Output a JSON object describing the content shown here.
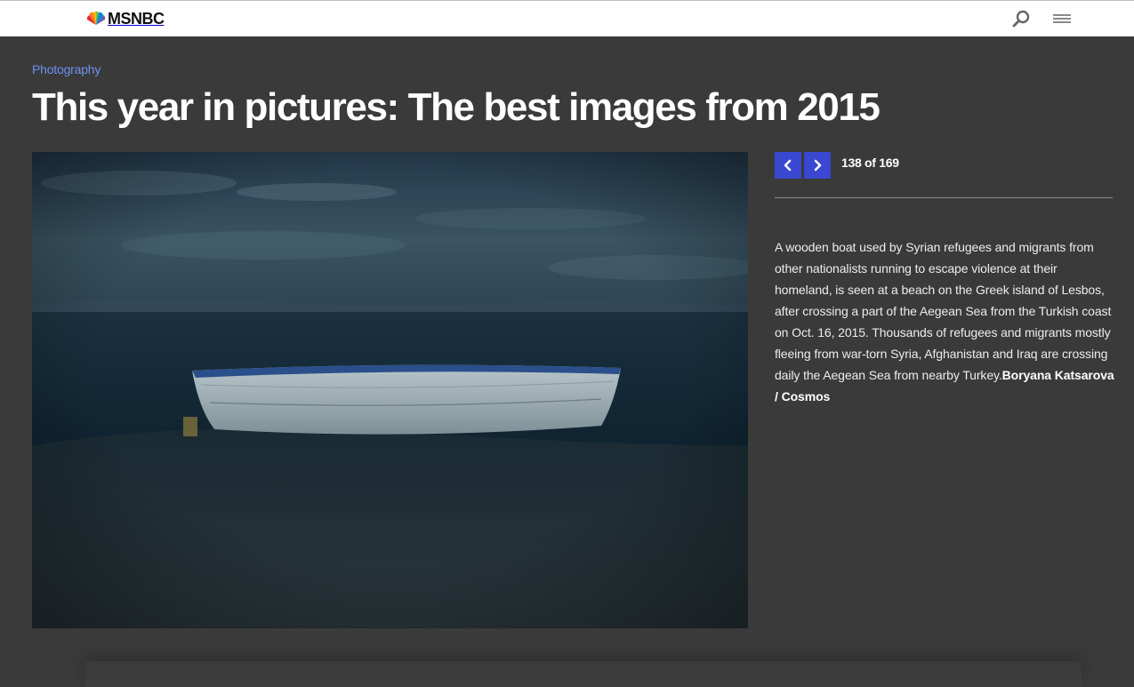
{
  "header": {
    "logo_text": "MSNBC",
    "search_icon": "search-icon",
    "menu_icon": "hamburger-menu-icon"
  },
  "article": {
    "section": "Photography",
    "title": "This year in pictures: The best images from 2015"
  },
  "gallery": {
    "prev_icon": "chevron-left-icon",
    "next_icon": "chevron-right-icon",
    "counter": "138 of 169",
    "current_index": 138,
    "total": 169,
    "caption": "A wooden boat used by Syrian refugees and migrants from other nationalists running to escape violence at their homeland, is seen at a beach on the Greek island of Lesbos, after crossing a part of the Aegean Sea from the Turkish coast on Oct. 16, 2015. Thousands of refugees and migrants mostly fleeing from war-torn Syria, Afghanistan and Iraq are crossing daily the Aegean Sea from nearby Turkey.",
    "credit": "Boryana Katsarova / Cosmos"
  },
  "colors": {
    "background": "#3a3a3a",
    "accent_link": "#6f8ff2",
    "nav_button": "#3a47d1"
  }
}
